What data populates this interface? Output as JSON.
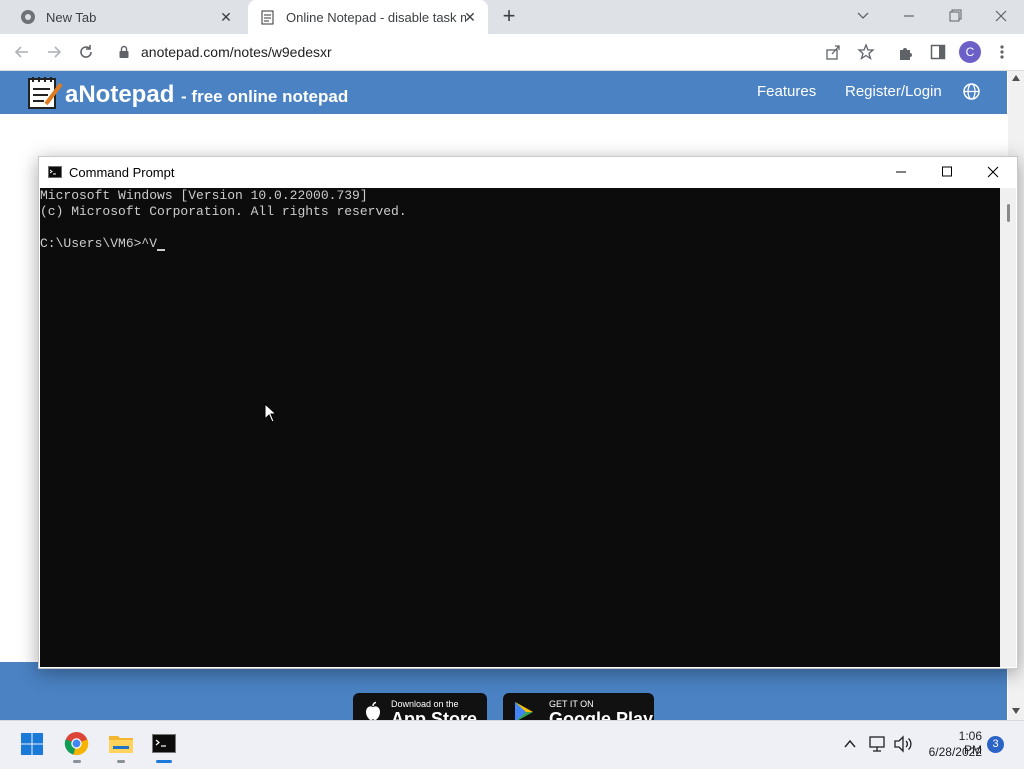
{
  "browser": {
    "tabs": [
      {
        "title": "New Tab"
      },
      {
        "title": "Online Notepad - disable task m"
      }
    ],
    "address": "anotepad.com/notes/w9edesxr",
    "profile_initial": "C"
  },
  "site": {
    "logo": "aNotepad",
    "tagline": "- free online notepad",
    "nav": [
      "Features",
      "Register/Login"
    ],
    "app_store": {
      "small": "Download on the",
      "big": "App Store"
    },
    "google_play": {
      "small": "GET IT ON",
      "big": "Google Play"
    }
  },
  "cmd": {
    "title": "Command Prompt",
    "lines": [
      "Microsoft Windows [Version 10.0.22000.739]",
      "(c) Microsoft Corporation. All rights reserved.",
      "",
      "C:\\Users\\VM6>^V"
    ]
  },
  "taskbar": {
    "time": "1:06 PM",
    "date": "6/28/2022",
    "notifications": "3"
  },
  "colors": {
    "site_blue": "#4a82c3",
    "terminal_bg": "#0c0c0c",
    "terminal_text": "#cccccc"
  }
}
